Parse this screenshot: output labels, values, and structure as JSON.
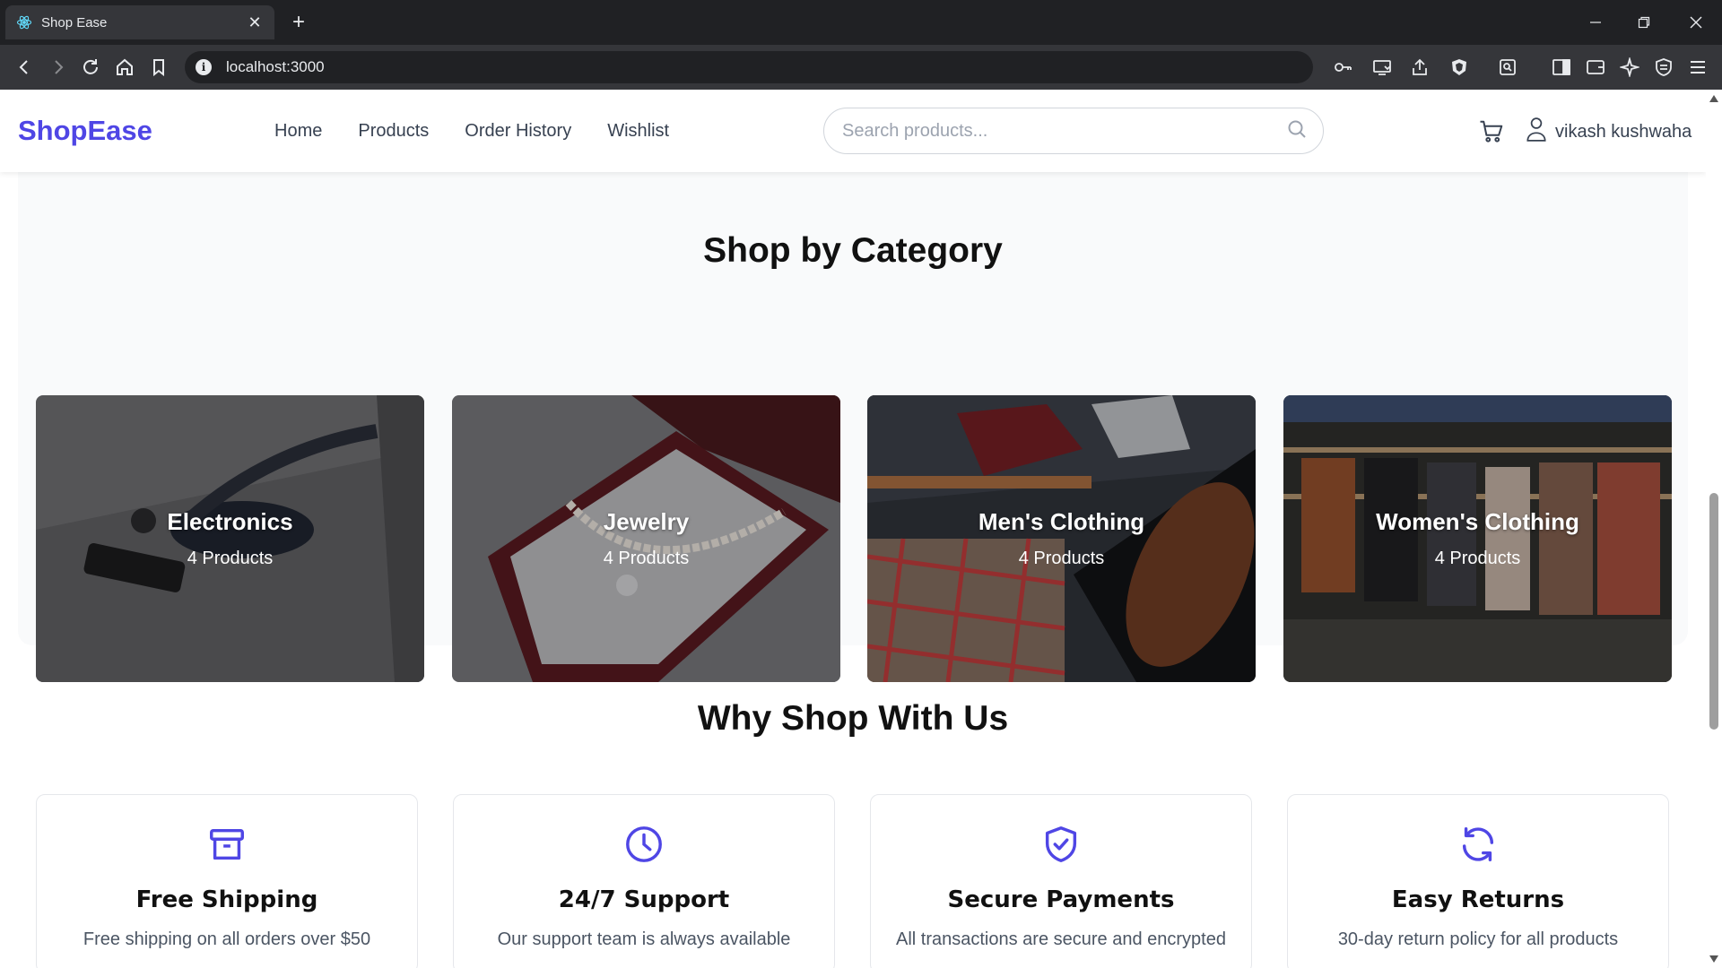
{
  "browser": {
    "tab_title": "Shop Ease",
    "url": "localhost:3000"
  },
  "header": {
    "logo": "ShopEase",
    "nav": [
      "Home",
      "Products",
      "Order History",
      "Wishlist"
    ],
    "search_placeholder": "Search products...",
    "user_name": "vikash kushwaha"
  },
  "categories": {
    "title": "Shop by Category",
    "items": [
      {
        "name": "Electronics",
        "count": "4 Products"
      },
      {
        "name": "Jewelry",
        "count": "4 Products"
      },
      {
        "name": "Men's Clothing",
        "count": "4 Products"
      },
      {
        "name": "Women's Clothing",
        "count": "4 Products"
      }
    ]
  },
  "why": {
    "title": "Why Shop With Us",
    "features": [
      {
        "title": "Free Shipping",
        "desc": "Free shipping on all orders over $50",
        "icon": "archive-box-icon"
      },
      {
        "title": "24/7 Support",
        "desc": "Our support team is always available",
        "icon": "clock-icon"
      },
      {
        "title": "Secure Payments",
        "desc": "All transactions are secure and encrypted",
        "icon": "shield-check-icon"
      },
      {
        "title": "Easy Returns",
        "desc": "30-day return policy for all products",
        "icon": "refresh-icon"
      }
    ]
  },
  "colors": {
    "brand": "#4f46e5",
    "browser_bg": "#202124",
    "browser_toolbar": "#35363a",
    "section_bg": "#f9fafb"
  }
}
